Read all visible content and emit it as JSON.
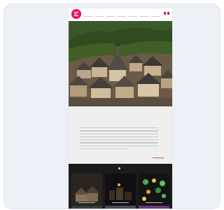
{
  "colors": {
    "brand": "#e6185c",
    "title_accent": "#9b5878",
    "panel_bg": "#efefef",
    "grid_bg": "#1b1b1b"
  },
  "header": {
    "logo_icon": "brand-logo-icon",
    "nav": [
      "",
      "",
      "",
      "",
      "",
      "",
      ""
    ],
    "flags": [
      "flag-icon",
      "flag-icon"
    ]
  },
  "hero": {
    "caption": ""
  },
  "welcome": {
    "title": "",
    "subtitle": ""
  },
  "tiles": [
    {
      "label": "",
      "icon": "village-photo"
    },
    {
      "label": "",
      "icon": "night-photo"
    },
    {
      "label": "",
      "icon": "lights-photo"
    }
  ]
}
